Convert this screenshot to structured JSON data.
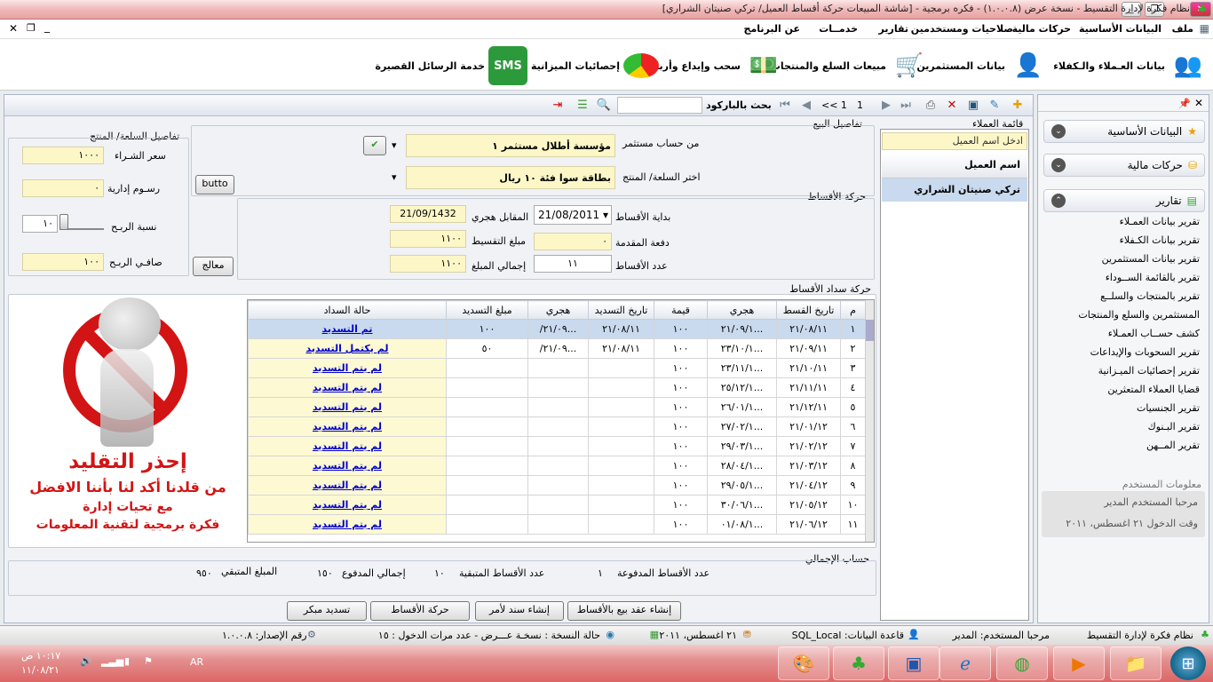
{
  "window": {
    "title": "نظام فكرة لإدارة التقسيط - نسخة عرض (١.٠.٠.٨) - فكره برمجية - [شاشة المبيعات    حركة أقساط العميل/ تركي صنيتان الشراري]"
  },
  "menu": {
    "file": "ملف",
    "basic": "البيانات الأساسية",
    "finance": "حركات مالية",
    "permissions": "صلاحيات ومستخدمين",
    "reports": "تقارير",
    "services": "خدمــات",
    "about": "عن البرنامج"
  },
  "ribbon": {
    "customers": "بيانات العـملاء والـكفلاء",
    "investors": "بيانات المستثمرين",
    "sales": "مبيعات السلع والمنتجات",
    "withdraw": "سحب وإيداع وأرباح",
    "budget": "إحصائيات الميزانية",
    "sms": "خدمة الرسائل القصيرة",
    "sms_icon": "SMS"
  },
  "toolbar": {
    "barcode_search": "بحث بالباركود",
    "page": "1",
    "pager": "<< 1"
  },
  "customers_list": {
    "title": "قائمة العملاء",
    "search_placeholder": "ادخل اسم العميل",
    "header": "اسم العميل",
    "items": [
      "تركي صنيتان الشراري"
    ]
  },
  "sale_details": {
    "title": "تفاصيل البيع",
    "investor_label": "من حساب مستثمر",
    "investor_value": "مؤسسة أطلال مستثمر ١",
    "product_label": "اختر السلعة/ المنتج",
    "product_value": "بطاقة سوا فئة ١٠ ريال",
    "side_button": "butto"
  },
  "product_details": {
    "title": "تفاصيل السلعة/ المنتج",
    "buy_price_label": "سعر الشـراء",
    "buy_price": "١٠٠٠",
    "admin_fee_label": "رسـوم إدارية",
    "admin_fee": "٠",
    "profit_rate_label": "نسبة الربـح",
    "profit_rate": "١٠",
    "net_profit_label": "صافـي الربـح",
    "net_profit": "١٠٠",
    "process_button": "معالج"
  },
  "installments": {
    "title": "حركة الأقساط",
    "start_label": "بداية الأقساط",
    "start_date": "21/08/2011",
    "hijri_label": "المقابل هجري",
    "hijri_date": "21/09/1432",
    "down_label": "دفعة المقدمة",
    "down_payment": "٠",
    "amount_label": "مبلغ التقسيط",
    "amount": "١١٠٠",
    "count_label": "عدد الأقساط",
    "count": "١١",
    "total_label": "إجمالي المبلغ",
    "total": "١١٠٠"
  },
  "payments": {
    "title": "حركة سداد الأقساط",
    "columns": [
      "م",
      "تاريخ القسط",
      "هجري",
      "قيمة",
      "تاريخ التسديد",
      "هجري",
      "مبلغ التسديد",
      "حالة السداد"
    ],
    "rows": [
      [
        "١",
        "٢١/٠٨/١١",
        "...٢١/٠٩/١",
        "١٠٠",
        "٢١/٠٨/١١",
        "...٢١/٠٩/",
        "١٠٠",
        "تم التسديد"
      ],
      [
        "٢",
        "٢١/٠٩/١١",
        "...٢٣/١٠/١",
        "١٠٠",
        "٢١/٠٨/١١",
        "...٢١/٠٩/",
        "٥٠",
        "لم يكتمل التسديد"
      ],
      [
        "٣",
        "٢١/١٠/١١",
        "...٢٣/١١/١",
        "١٠٠",
        "",
        "",
        "",
        "لم يتم التسديد"
      ],
      [
        "٤",
        "٢١/١١/١١",
        "...٢٥/١٢/١",
        "١٠٠",
        "",
        "",
        "",
        "لم يتم التسديد"
      ],
      [
        "٥",
        "٢١/١٢/١١",
        "...٢٦/٠١/١",
        "١٠٠",
        "",
        "",
        "",
        "لم يتم التسديد"
      ],
      [
        "٦",
        "٢١/٠١/١٢",
        "...٢٧/٠٢/١",
        "١٠٠",
        "",
        "",
        "",
        "لم يتم التسديد"
      ],
      [
        "٧",
        "٢١/٠٢/١٢",
        "...٢٩/٠٣/١",
        "١٠٠",
        "",
        "",
        "",
        "لم يتم التسديد"
      ],
      [
        "٨",
        "٢١/٠٣/١٢",
        "...٢٨/٠٤/١",
        "١٠٠",
        "",
        "",
        "",
        "لم يتم التسديد"
      ],
      [
        "٩",
        "٢١/٠٤/١٢",
        "...٢٩/٠٥/١",
        "١٠٠",
        "",
        "",
        "",
        "لم يتم التسديد"
      ],
      [
        "١٠",
        "٢١/٠٥/١٢",
        "...٣٠/٠٦/١",
        "١٠٠",
        "",
        "",
        "",
        "لم يتم التسديد"
      ],
      [
        "١١",
        "٢١/٠٦/١٢",
        "...٠١/٠٨/١",
        "١٠٠",
        "",
        "",
        "",
        "لم يتم التسديد"
      ]
    ]
  },
  "warning": {
    "line1": "إحذر التقليد",
    "line2": "من قلدنا أكد لنا بأننا الافضل",
    "line3": "مع تحيات إدارة",
    "line4": "فكرة برمجية لتقنية المعلومات"
  },
  "summary": {
    "title": "حساب الإجمالي",
    "paid_count_label": "عدد الأقساط المدفوعة",
    "paid_count": "١",
    "remaining_count_label": "عدد الأقساط المتبقية",
    "remaining_count": "١٠",
    "paid_total_label": "إجمالي المدفوع",
    "paid_total": "١٥٠",
    "remaining_total_label": "المبلغ المتبقي",
    "remaining_total": "٩٥٠"
  },
  "actions": {
    "create_contract": "إنشاء عقد بيع بالأقساط",
    "create_order": "إنشاء سند لأمر",
    "installments_movement": "حركة الأقساط",
    "early_payment": "تسديد مبكر"
  },
  "sidenav": {
    "sections": [
      "البيانات الأساسية",
      "حركات مالية",
      "تقارير"
    ],
    "reports": [
      "تقرير بيانات العمـلاء",
      "تقرير بيانات الكـفلاء",
      "تقرير بيانات المستثمرين",
      "تقرير بالقائمة الســوداء",
      "تقرير بالمنتجات والسلــع",
      "المستثمرين والسلع والمنتجات",
      "كشف حســاب العمـلاء",
      "تقرير السحوبات والإيداعات",
      "تقرير إحصائيات الميـزانية",
      "قضايا العملاء المتعثرين",
      "تقرير الجنسيات",
      "تقرير البـنوك",
      "تقرير المــهن"
    ],
    "user_title": "معلومات المستخدم",
    "welcome": "مرحبا المستخدم المدير",
    "login_time": "وقت الدخول ٢١ اغسطس، ٢٠١١"
  },
  "statusbar": {
    "app": "نظام فكرة لإدارة التقسيط",
    "user": "مرحبا المستخدم: المدير",
    "db": "قاعدة البيانات: SQL_Local",
    "date": "٢١ اغسطس، ٢٠١١",
    "version_state": "حالة النسخة : نسخـة عـــرض - عدد مرات الدخول : ١٥",
    "version": "رقم الإصدار: ١.٠.٠.٨"
  },
  "taskbar": {
    "lang": "AR",
    "time": "١٠:١٧ ص",
    "date": "١١/٠٨/٢١"
  }
}
